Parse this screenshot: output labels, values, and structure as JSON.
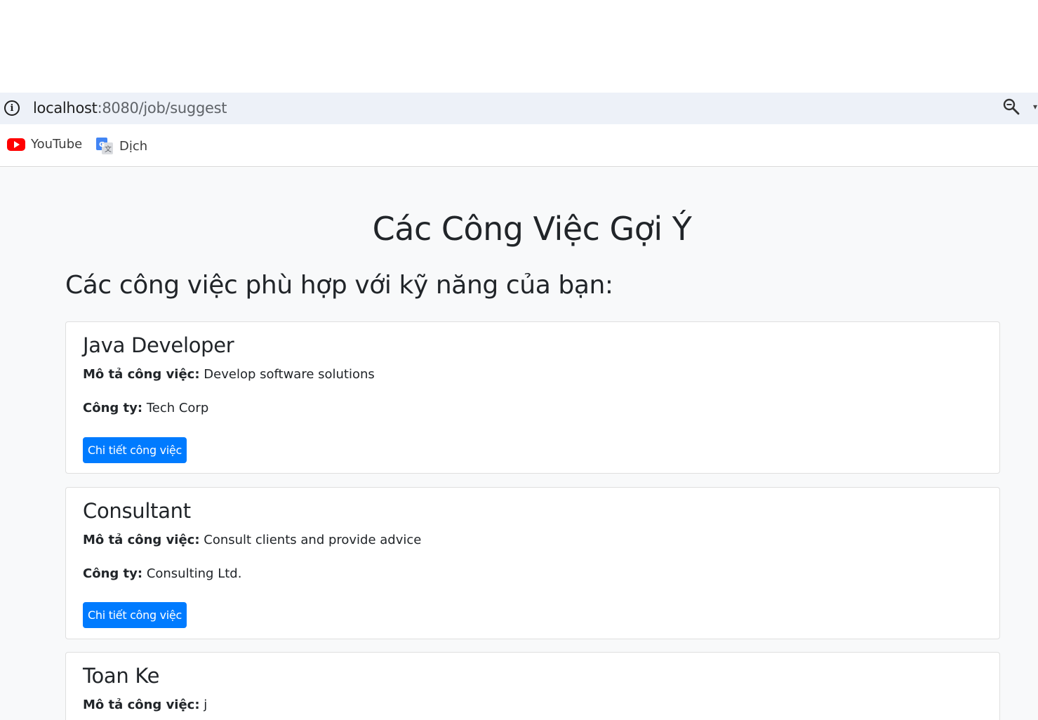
{
  "browser": {
    "url_host": "localhost",
    "url_path": ":8080/job/suggest",
    "bookmarks": [
      {
        "label": "YouTube",
        "icon": "youtube-icon"
      },
      {
        "label": "Dịch",
        "icon": "google-translate-icon"
      }
    ]
  },
  "page": {
    "title": "Các Công Việc Gợi Ý",
    "subtitle": "Các công việc phù hợp với kỹ năng của bạn:",
    "desc_label": "Mô tả công việc:",
    "company_label": "Công ty:",
    "button_label": "Chi tiết công việc",
    "accent_color": "#007bff",
    "jobs": [
      {
        "title": "Java Developer",
        "description": "Develop software solutions",
        "company": "Tech Corp"
      },
      {
        "title": "Consultant",
        "description": "Consult clients and provide advice",
        "company": "Consulting Ltd."
      },
      {
        "title": "Toan Ke",
        "description": "j",
        "company": ""
      }
    ]
  }
}
